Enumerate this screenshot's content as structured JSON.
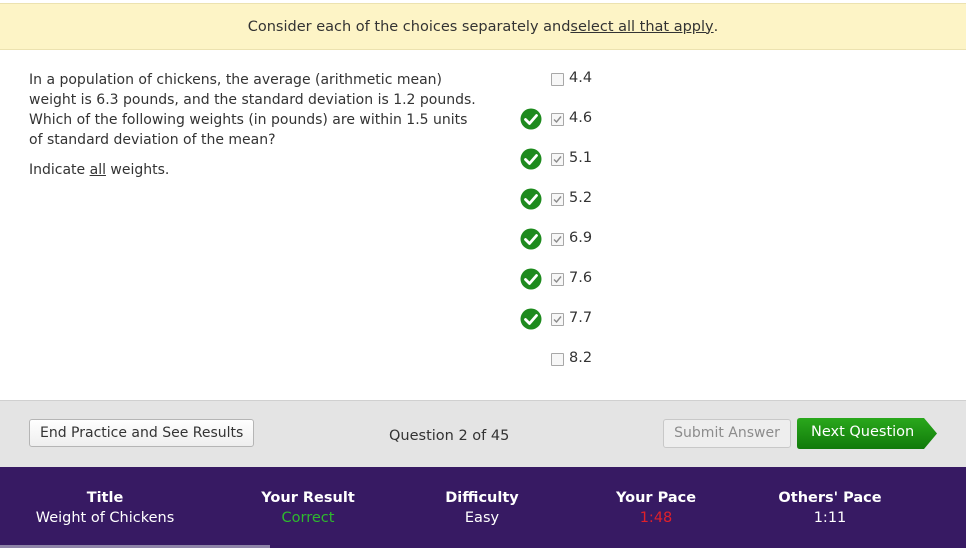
{
  "instruction": {
    "prefix": "Consider each of the choices separately and ",
    "link": "select all that apply",
    "suffix": "."
  },
  "question": {
    "text": "In a population of chickens, the average (arithmetic mean) weight is 6.3 pounds, and the standard deviation is 1.2 pounds. Which of the following weights (in pounds) are within 1.5 units of standard deviation of the mean?",
    "indicate_prefix": "Indicate ",
    "indicate_underlined": "all",
    "indicate_suffix": " weights."
  },
  "choices": [
    {
      "label": "4.4",
      "checked": false,
      "correct_mark": false
    },
    {
      "label": "4.6",
      "checked": true,
      "correct_mark": true
    },
    {
      "label": "5.1",
      "checked": true,
      "correct_mark": true
    },
    {
      "label": "5.2",
      "checked": true,
      "correct_mark": true
    },
    {
      "label": "6.9",
      "checked": true,
      "correct_mark": true
    },
    {
      "label": "7.6",
      "checked": true,
      "correct_mark": true
    },
    {
      "label": "7.7",
      "checked": true,
      "correct_mark": true
    },
    {
      "label": "8.2",
      "checked": false,
      "correct_mark": false
    }
  ],
  "toolbar": {
    "end_label": "End Practice and See Results",
    "progress": "Question 2 of 45",
    "submit_label": "Submit Answer",
    "next_label": "Next Question"
  },
  "stats": {
    "title_head": "Title",
    "title_val": "Weight of Chickens",
    "result_head": "Your Result",
    "result_val": "Correct",
    "difficulty_head": "Difficulty",
    "difficulty_val": "Easy",
    "pace_head": "Your Pace",
    "pace_val": "1:48",
    "others_head": "Others' Pace",
    "others_val": "1:11"
  },
  "colors": {
    "correct": "#2eb82e",
    "slow_pace": "#e0202a",
    "check_green": "#1e8a1e",
    "next_button": "#1c8f12",
    "stats_bg": "#371a63"
  }
}
